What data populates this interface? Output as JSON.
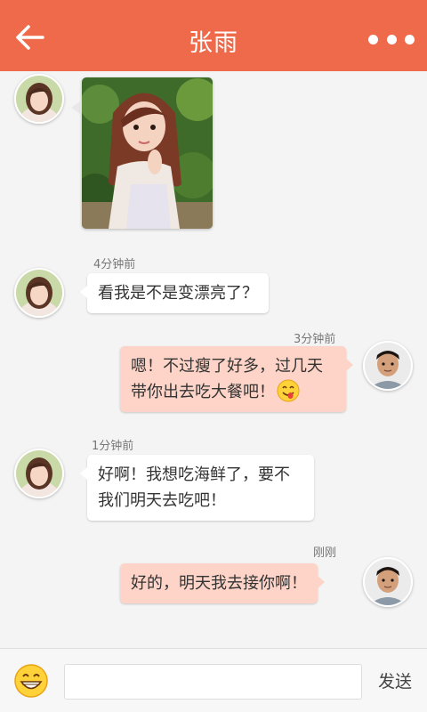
{
  "header": {
    "title": "张雨",
    "back_icon": "arrow-left-icon",
    "more_icon": "more-dots-icon",
    "color": "#ef6a4b"
  },
  "messages": [
    {
      "id": 1,
      "side": "left",
      "sender": "张雨",
      "type": "image",
      "time": ""
    },
    {
      "id": 2,
      "side": "left",
      "sender": "张雨",
      "type": "text",
      "time": "4分钟前",
      "text": "看我是不是变漂亮了？"
    },
    {
      "id": 3,
      "side": "right",
      "sender": "me",
      "type": "text",
      "time": "3分钟前",
      "line1": "嗯！不过瘦了好多，过几天",
      "line2": "带你出去吃大餐吧！",
      "emoji": "yum-emoji-icon"
    },
    {
      "id": 4,
      "side": "left",
      "sender": "张雨",
      "type": "text",
      "time": "1分钟前",
      "line1": "好啊！我想吃海鲜了，要不",
      "line2": "我们明天去吃吧！"
    },
    {
      "id": 5,
      "side": "right",
      "sender": "me",
      "type": "text",
      "time": "刚刚",
      "text": "好的，明天我去接你啊！"
    }
  ],
  "input_bar": {
    "emoji_icon": "grin-emoji-icon",
    "input_value": "",
    "input_placeholder": "",
    "send_label": "发送"
  },
  "colors": {
    "accent": "#ef6a4b",
    "own_bubble": "#fdd4c7",
    "other_bubble": "#ffffff",
    "background": "#f4f4f4"
  }
}
